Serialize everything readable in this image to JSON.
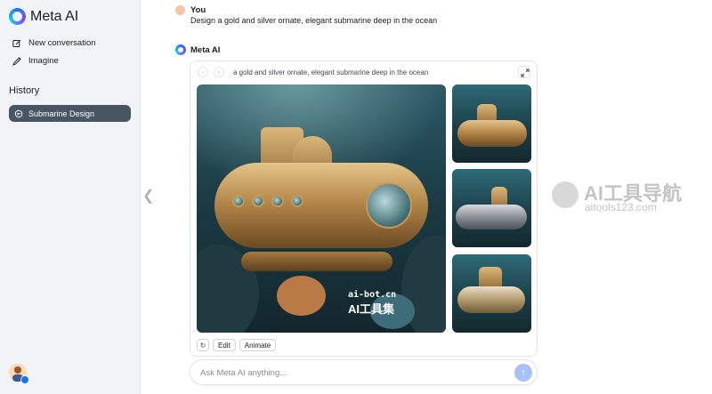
{
  "sidebar": {
    "app_title": "Meta AI",
    "nav": [
      {
        "label": "New conversation",
        "icon": "compose-icon"
      },
      {
        "label": "Imagine",
        "icon": "pencil-icon"
      }
    ],
    "history_title": "History",
    "history_items": [
      {
        "label": "Submarine Design",
        "icon": "chat-bubble-icon"
      }
    ],
    "collapse_glyph": "❮"
  },
  "conversation": {
    "user": {
      "name": "You",
      "message": "Design a gold and silver ornate, elegant submarine deep in the ocean"
    },
    "assistant": {
      "name": "Meta AI",
      "image_caption": "a gold and silver ornate, elegant submarine deep in the ocean",
      "prev_glyph": "‹",
      "next_glyph": "›",
      "actions": {
        "refresh_glyph": "↻",
        "edit_label": "Edit",
        "animate_label": "Animate"
      }
    }
  },
  "watermarks": {
    "image_url": "ai-bot.cn",
    "image_name": "AI工具集",
    "site_name": "AI工具导航",
    "site_url": "aitools123.com"
  },
  "composer": {
    "placeholder": "Ask Meta AI anything...",
    "send_glyph": "↑"
  },
  "colors": {
    "accent": "#1f6fff",
    "history_active_bg": "#4a5563",
    "send_button": "#a7c3f5"
  }
}
